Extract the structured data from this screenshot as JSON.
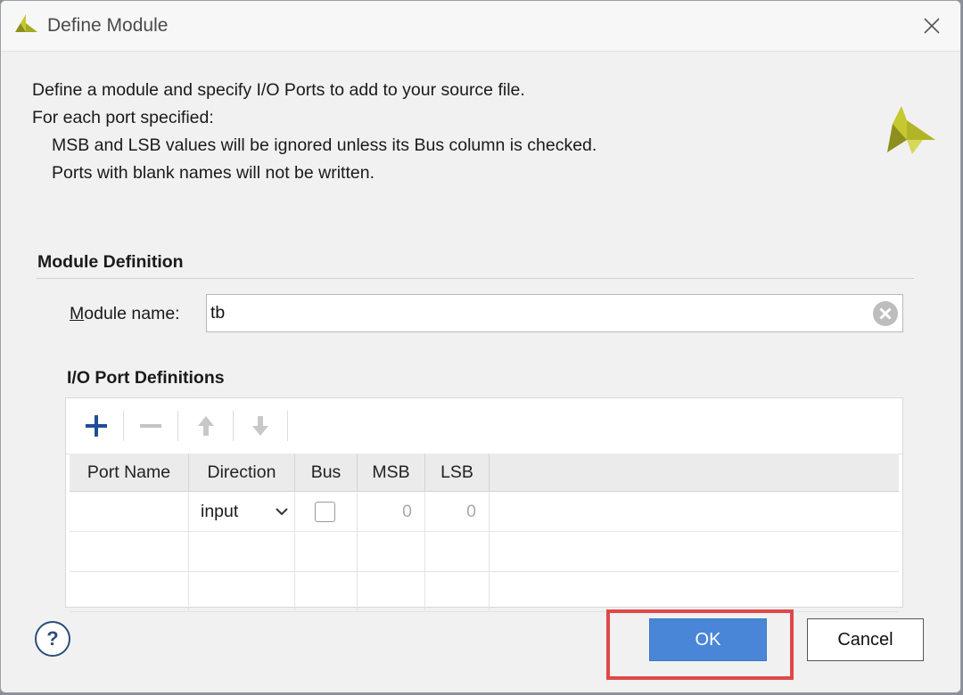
{
  "window": {
    "title": "Define Module"
  },
  "description": {
    "line1": "Define a module and specify I/O Ports to add to your source file.",
    "line2": "For each port specified:",
    "line3": "MSB and LSB values will be ignored unless its Bus column is checked.",
    "line4": "Ports with blank names will not be written."
  },
  "module_definition": {
    "section_title": "Module Definition",
    "name_label_first": "M",
    "name_label_rest": "odule name:",
    "name_value": "tb"
  },
  "io_ports": {
    "section_title": "I/O Port Definitions",
    "toolbar": [
      "add-icon",
      "remove-icon",
      "move-up-icon",
      "move-down-icon"
    ],
    "columns": [
      "Port Name",
      "Direction",
      "Bus",
      "MSB",
      "LSB"
    ],
    "rows": [
      {
        "port_name": "",
        "direction": "input",
        "bus": false,
        "msb": "0",
        "lsb": "0"
      }
    ]
  },
  "buttons": {
    "help": "?",
    "ok": "OK",
    "cancel": "Cancel"
  },
  "colors": {
    "ok_button": "#4a86d7",
    "highlight": "#e04848",
    "logo": "#b5b82a"
  }
}
